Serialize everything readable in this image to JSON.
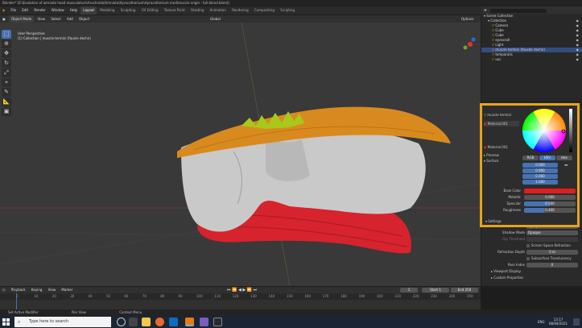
{
  "window": {
    "title": "Blender* [E:\\Evolution of amniote head musculature\\Arachnida\\Amniota\\Hyracotherium\\Hyracotherium mod\\muscle origin - full blend.blend]"
  },
  "menus": [
    "File",
    "Edit",
    "Render",
    "Window",
    "Help"
  ],
  "workspaces": [
    "Layout",
    "Modeling",
    "Sculpting",
    "UV Editing",
    "Texture Paint",
    "Shading",
    "Animation",
    "Rendering",
    "Compositing",
    "Scripting"
  ],
  "active_workspace": "Layout",
  "scene": {
    "label": "Scene",
    "view_layer": "View Layer"
  },
  "viewport": {
    "mode": "Object Mode",
    "menus": [
      "View",
      "Select",
      "Add",
      "Object"
    ],
    "transform": "Global",
    "options": "Options",
    "info_line1": "User Perspective",
    "info_line2": "(1) Collection | muscle termini (faunie dechn)"
  },
  "tools": [
    "cursor-select",
    "cursor",
    "move",
    "rotate",
    "scale",
    "transform",
    "annotate",
    "measure",
    "add-cube"
  ],
  "outliner": {
    "search_placeholder": "",
    "items": [
      {
        "label": "Scene Collection",
        "indent": 0
      },
      {
        "label": "Collection",
        "indent": 1
      },
      {
        "label": "Camera",
        "indent": 2
      },
      {
        "label": "Cube",
        "indent": 2
      },
      {
        "label": "Cube",
        "indent": 2
      },
      {
        "label": "eyescroll",
        "indent": 2
      },
      {
        "label": "Light",
        "indent": 2
      },
      {
        "label": "muscle termini (fauxde dechn)",
        "indent": 2
      },
      {
        "label": "temporalis",
        "indent": 2
      },
      {
        "label": "uuc",
        "indent": 2
      }
    ]
  },
  "properties": {
    "object_name": "muscle termini",
    "material_name": "Material.001",
    "surface_label": "Surface",
    "preview_label": "Preview",
    "picker_tabs": [
      "RGB",
      "HSV",
      "Hex"
    ],
    "rows": [
      {
        "label": "Base Color",
        "value": ""
      },
      {
        "label": "Metallic",
        "value": "0.000"
      },
      {
        "label": "Specular",
        "value": "0.500"
      },
      {
        "label": "Roughness",
        "value": "0.400"
      }
    ],
    "settings_label": "Settings",
    "hsv_values": [
      "0.000",
      "0.900",
      "0.900",
      "1.000"
    ],
    "extra_rows": [
      {
        "label": "Blend Mode",
        "value": "Opaque"
      },
      {
        "label": "Shadow Mode",
        "value": "Opaque"
      },
      {
        "label": "Clip Threshold",
        "value": ""
      },
      {
        "label": "",
        "value": "Screen Space Refraction"
      },
      {
        "label": "Refraction Depth",
        "value": "0 m"
      },
      {
        "label": "",
        "value": "Subsurface Translucency"
      },
      {
        "label": "Pass Index",
        "value": "0"
      }
    ],
    "viewport_display": "Viewport Display",
    "custom_properties": "Custom Properties"
  },
  "timeline": {
    "menus": [
      "Playback",
      "Keying",
      "View",
      "Marker"
    ],
    "current_frame": "1",
    "start_label": "Start",
    "start": "1",
    "end_label": "End",
    "end": "250",
    "ticks": [
      "0",
      "10",
      "20",
      "30",
      "40",
      "50",
      "60",
      "70",
      "80",
      "90",
      "100",
      "110",
      "120",
      "130",
      "140",
      "150",
      "160",
      "170",
      "180",
      "190",
      "200",
      "210",
      "220",
      "230",
      "240",
      "250"
    ]
  },
  "statusbar": {
    "left": "Set Active Modifier",
    "mid": "Pan View",
    "right": "Context Menu"
  },
  "taskbar": {
    "search_placeholder": "Type here to search",
    "lang": "ENG",
    "time": "13:17",
    "date": "08/04/2021"
  },
  "colors": {
    "accent": "#4772b3",
    "highlight": "#e8a317",
    "muscle_red": "#d6232e",
    "muscle_orange": "#d98a1e",
    "bone": "#c9c9c9"
  }
}
